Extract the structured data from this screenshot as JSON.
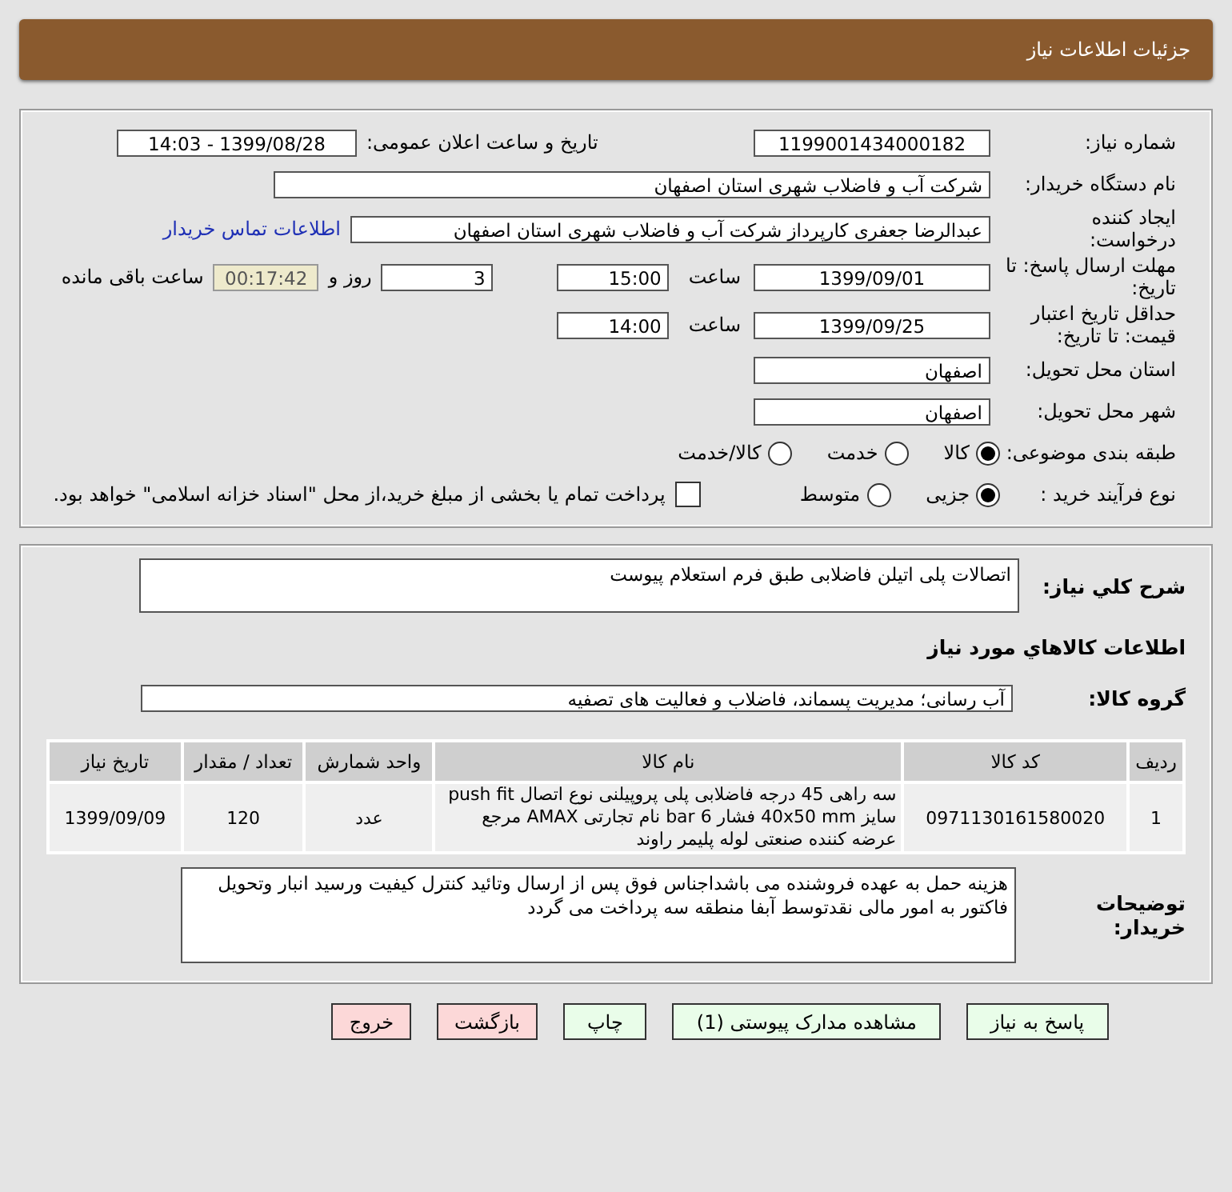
{
  "header": {
    "title": "جزئیات اطلاعات نیاز"
  },
  "need_number": {
    "label": "شماره نیاز:",
    "value": "1199001434000182"
  },
  "announce": {
    "label": "تاریخ و ساعت اعلان عمومی:",
    "value": "1399/08/28 - 14:03"
  },
  "buyer_org": {
    "label": "نام دستگاه خریدار:",
    "value": "شرکت آب و فاضلاب شهری استان اصفهان"
  },
  "requester": {
    "label": "ایجاد کننده درخواست:",
    "value": "عبدالرضا جعفری کارپرداز شرکت آب و فاضلاب شهری استان اصفهان",
    "link": "اطلاعات تماس خریدار"
  },
  "deadline": {
    "label": "مهلت ارسال پاسخ: تا تاریخ:",
    "date": "1399/09/01",
    "time_label": "ساعت",
    "time": "15:00",
    "days": "3",
    "days_label": "روز و",
    "remaining": "00:17:42",
    "remaining_label": "ساعت باقی مانده"
  },
  "validity": {
    "label": "حداقل تاریخ اعتبار قیمت: تا تاریخ:",
    "date": "1399/09/25",
    "time_label": "ساعت",
    "time": "14:00"
  },
  "province": {
    "label": "استان محل تحویل:",
    "value": "اصفهان"
  },
  "city": {
    "label": "شهر محل تحویل:",
    "value": "اصفهان"
  },
  "category": {
    "label": "طبقه بندی موضوعی:",
    "options": [
      {
        "label": "کالا",
        "selected": true
      },
      {
        "label": "خدمت",
        "selected": false
      },
      {
        "label": "کالا/خدمت",
        "selected": false
      }
    ]
  },
  "process": {
    "label": "نوع فرآیند خرید :",
    "options": [
      {
        "label": "جزیی",
        "selected": true
      },
      {
        "label": "متوسط",
        "selected": false
      }
    ],
    "treasury": {
      "label": "پرداخت تمام یا بخشی از مبلغ خرید،از محل \"اسناد خزانه اسلامی\" خواهد بود.",
      "checked": false
    }
  },
  "description": {
    "label": "شرح کلي نياز:",
    "value": "اتصالات پلی اتیلن فاضلابی طبق فرم استعلام پیوست"
  },
  "goods_heading": "اطلاعات کالاهاي مورد نياز",
  "goods_group": {
    "label": "گروه کالا:",
    "value": "آب رسانی؛ مدیریت پسماند، فاضلاب و فعالیت های تصفیه"
  },
  "table": {
    "columns": [
      "ردیف",
      "کد کالا",
      "نام کالا",
      "واحد شمارش",
      "تعداد / مقدار",
      "تاریخ نیاز"
    ],
    "rows": [
      {
        "cells": [
          "1",
          "0971130161580020",
          "سه راهی 45 درجه فاضلابی پلی پروپیلنی نوع اتصال push fit سایز 40x50 mm فشار 6 bar نام تجارتی AMAX مرجع عرضه کننده صنعتی لوله پلیمر راوند",
          "عدد",
          "120",
          "1399/09/09"
        ]
      }
    ]
  },
  "buyer_notes": {
    "label": "توضیحات خریدار:",
    "value": "هزینه حمل به عهده فروشنده می باشداجناس فوق پس از ارسال وتائید کنترل کیفیت ورسید انبار وتحویل فاکتور به امور مالی نقدتوسط آبفا منطقه سه پرداخت می گردد"
  },
  "buttons": [
    {
      "label": "پاسخ به نیاز",
      "kind": "normal"
    },
    {
      "label": "مشاهده مدارک پیوستی (1)",
      "kind": "normal"
    },
    {
      "label": "چاپ",
      "kind": "normal"
    },
    {
      "label": "بازگشت",
      "kind": "danger"
    },
    {
      "label": "خروج",
      "kind": "danger"
    }
  ]
}
